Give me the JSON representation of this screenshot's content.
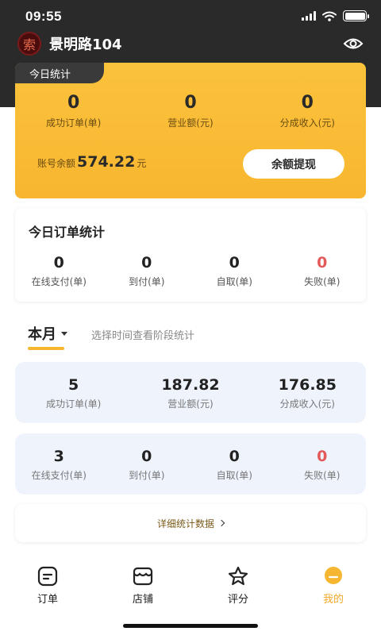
{
  "status": {
    "time": "09:55"
  },
  "store": {
    "logo_char": "索",
    "name": "景明路104"
  },
  "today": {
    "tab": "今日统计",
    "stats": [
      {
        "value": "0",
        "label": "成功订单(单)"
      },
      {
        "value": "0",
        "label": "营业额(元)"
      },
      {
        "value": "0",
        "label": "分成收入(元)"
      }
    ],
    "balance_label": "账号余额",
    "balance_value": "574.22",
    "balance_unit": "元",
    "withdraw_label": "余额提现"
  },
  "today_orders": {
    "title": "今日订单统计",
    "stats": [
      {
        "value": "0",
        "label": "在线支付(单)"
      },
      {
        "value": "0",
        "label": "到付(单)"
      },
      {
        "value": "0",
        "label": "自取(单)"
      },
      {
        "value": "0",
        "label": "失败(单)"
      }
    ]
  },
  "period": {
    "label": "本月",
    "hint": "选择时间查看阶段统计"
  },
  "month_summary": {
    "stats": [
      {
        "value": "5",
        "label": "成功订单(单)"
      },
      {
        "value": "187.82",
        "label": "营业额(元)"
      },
      {
        "value": "176.85",
        "label": "分成收入(元)"
      }
    ]
  },
  "month_orders": {
    "stats": [
      {
        "value": "3",
        "label": "在线支付(单)"
      },
      {
        "value": "0",
        "label": "到付(单)"
      },
      {
        "value": "0",
        "label": "自取(单)"
      },
      {
        "value": "0",
        "label": "失败(单)"
      }
    ]
  },
  "detail_link": "详细统计数据",
  "nav": {
    "items": [
      {
        "label": "订单",
        "icon": "order-icon"
      },
      {
        "label": "店铺",
        "icon": "store-icon"
      },
      {
        "label": "评分",
        "icon": "star-icon"
      },
      {
        "label": "我的",
        "icon": "profile-icon"
      }
    ]
  },
  "colors": {
    "accent": "#f6b632",
    "failure": "#e35a5a",
    "dark": "#2a2a2a",
    "card_blue": "#eef3fc"
  }
}
